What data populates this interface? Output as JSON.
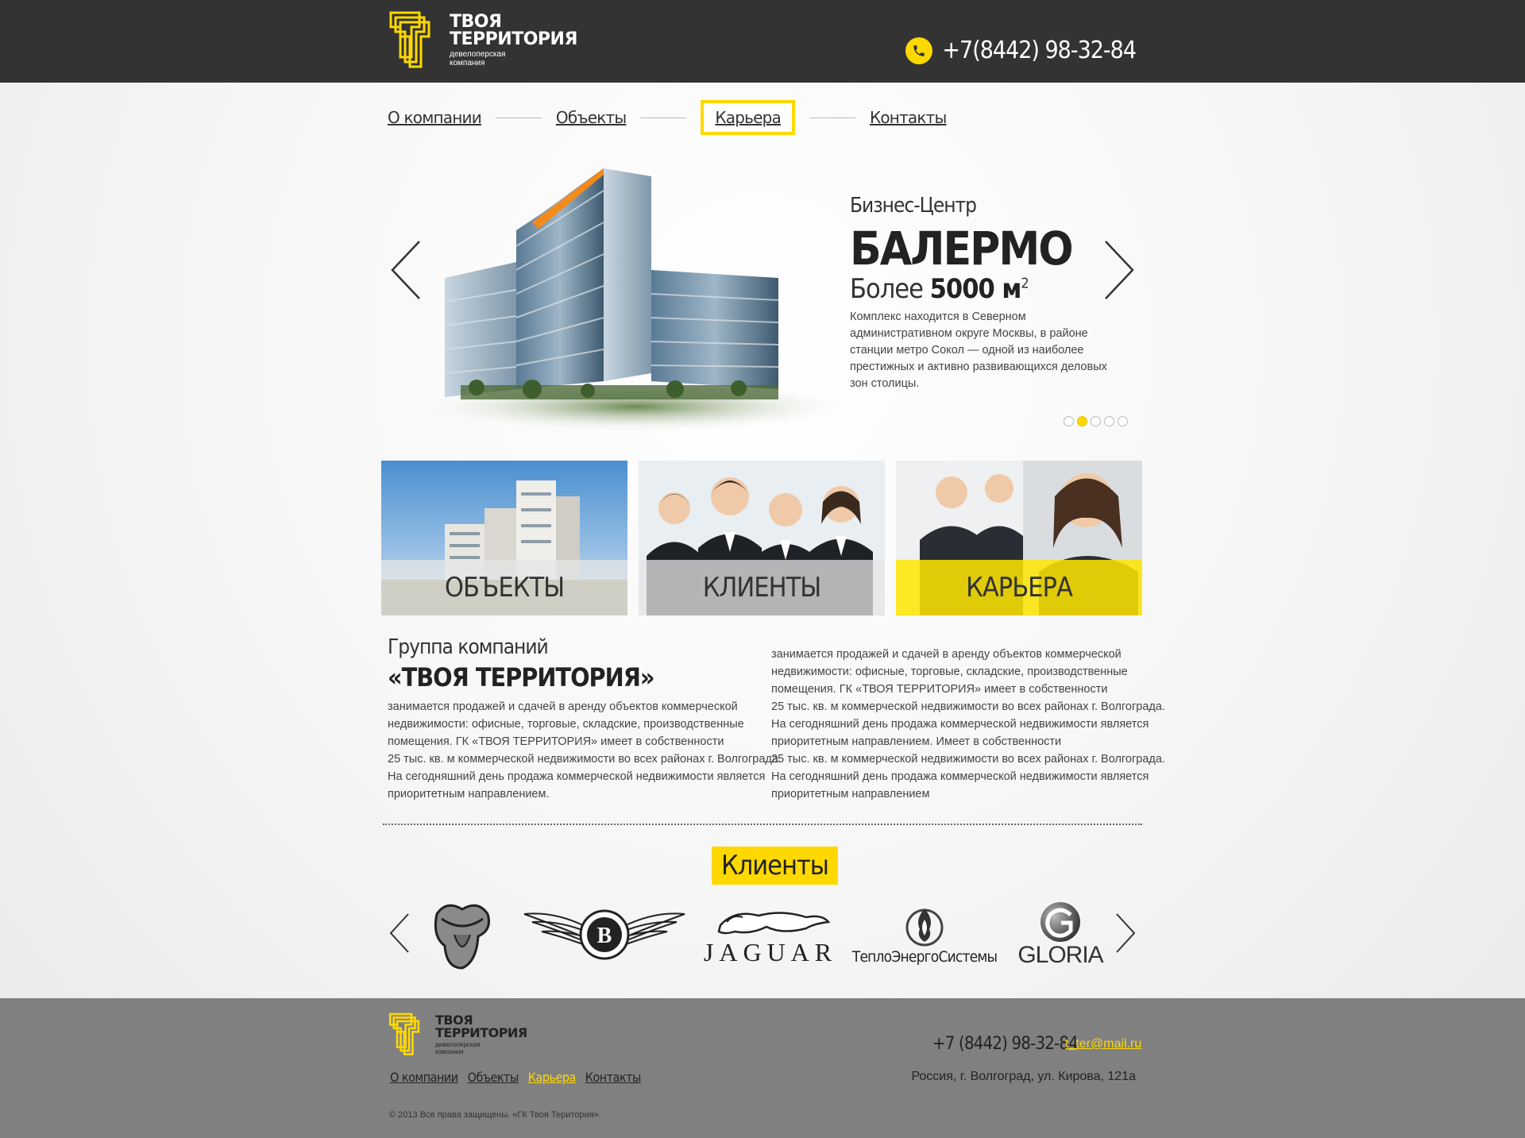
{
  "brand": {
    "name_line1": "ТВОЯ",
    "name_line2": "ТЕРРИТОРИЯ",
    "tagline": "девелоперская компания",
    "accent_color": "#ffd800",
    "header_bg": "#333333",
    "footer_bg": "#808080"
  },
  "header": {
    "phone": "+7(8442) 98-32-84",
    "phone_icon": "phone-icon"
  },
  "nav": {
    "items": [
      {
        "label": "О компании"
      },
      {
        "label": "Объекты"
      },
      {
        "label": "Карьера"
      },
      {
        "label": "Контакты"
      }
    ],
    "active": "Карьера"
  },
  "slider": {
    "subtitle": "Бизнес-Центр",
    "title": "БАЛЕРМО",
    "area_prefix": "Более",
    "area_value": "5000 м",
    "area_sup": "2",
    "description": "Комплекс находится в Северном административном округе Москвы, в районе станции метро Сокол — одной из наиболее престижных и активно развивающихся деловых зон столицы.",
    "dots_total": 5,
    "dots_active": 2
  },
  "tiles": [
    {
      "label": "ОБЪЕКТЫ"
    },
    {
      "label": "КЛИЕНТЫ"
    },
    {
      "label": "КАРЬЕРА"
    }
  ],
  "about": {
    "heading_small": "Группа компаний",
    "heading_big": "«ТВОЯ ТЕРРИТОРИЯ»",
    "col1": [
      "занимается продажей и сдачей в аренду объектов коммерческой",
      "недвижимости: офисные, торговые, складские, производственные",
      "помещения. ГК «ТВОЯ ТЕРРИТОРИЯ» имеет в собственности",
      "25 тыс. кв. м коммерческой недвижимости во всех районах г. Волгограда.",
      "На сегодняшний день продажа коммерческой недвижимости является",
      "приоритетным направлением."
    ],
    "col2": [
      "занимается продажей и сдачей в аренду объектов коммерческой",
      "недвижимости: офисные, торговые, складские, производственные",
      "помещения. ГК «ТВОЯ ТЕРРИТОРИЯ» имеет в собственности",
      "25 тыс. кв. м коммерческой недвижимости во всех районах г. Волгограда.",
      "На сегодняшний день продажа коммерческой недвижимости является",
      "приоритетным направлением.  Имеет в собственности",
      "25 тыс. кв. м коммерческой недвижимости во всех районах г. Волгограда.",
      "На сегодняшний день продажа коммерческой недвижимости является",
      "приоритетным направлением"
    ]
  },
  "clients": {
    "title": "Клиенты",
    "logos": [
      {
        "name": "rolling-stones-tongue-logo"
      },
      {
        "name": "bentley-logo"
      },
      {
        "name": "jaguar-logo",
        "text": "JAGUAR"
      },
      {
        "name": "teploenergosistemy-logo",
        "text": "ТеплоЭнергоСистемы"
      },
      {
        "name": "gloria-logo",
        "text": "GLORIA"
      }
    ]
  },
  "footer": {
    "nav": [
      {
        "label": "О компании"
      },
      {
        "label": "Объекты"
      },
      {
        "label": "Карьера"
      },
      {
        "label": "Контакты"
      }
    ],
    "phone": "+7 (8442) 98-32-84",
    "email": "t_ter@mail.ru",
    "address": "Россия, г. Волгоград, ул. Кирова, 121а",
    "copyright": "© 2013 Все права защищены. «ГК Твоя Територия»."
  }
}
